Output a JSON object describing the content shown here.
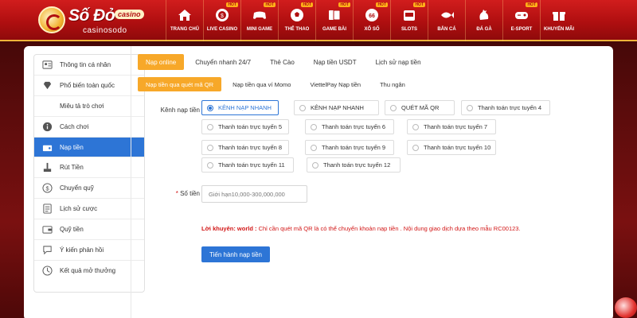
{
  "brand": {
    "name": "Số Đỏ",
    "badge": "casino",
    "subtitle": "casinosodo"
  },
  "nav": [
    {
      "label": "Trang chủ",
      "icon": "home-icon",
      "hot": ""
    },
    {
      "label": "Live Casino",
      "icon": "casino-chip-icon",
      "hot": "HOT"
    },
    {
      "label": "Mini Game",
      "icon": "gamepad-icon",
      "hot": "HOT"
    },
    {
      "label": "Thể Thao",
      "icon": "soccer-ball-icon",
      "hot": "HOT"
    },
    {
      "label": "Game Bài",
      "icon": "cards-icon",
      "hot": "HOT"
    },
    {
      "label": "Xổ Số",
      "icon": "lottery-ball-icon",
      "hot": "HOT"
    },
    {
      "label": "Slots",
      "icon": "slot-machine-icon",
      "hot": "HOT"
    },
    {
      "label": "Bắn Cá",
      "icon": "fish-icon",
      "hot": ""
    },
    {
      "label": "Đá Gà",
      "icon": "rooster-icon",
      "hot": ""
    },
    {
      "label": "E-Sport",
      "icon": "controller-icon",
      "hot": "HOT"
    },
    {
      "label": "Khuyến Mãi",
      "icon": "gift-icon",
      "hot": ""
    }
  ],
  "sidebar": [
    {
      "label": "Thông tin cá nhân",
      "icon": "profile-card-icon"
    },
    {
      "label": "Phổ biến toàn quốc",
      "icon": "diamond-icon"
    },
    {
      "label": "Miêu tả trò chơi",
      "icon": "gamepad-icon"
    },
    {
      "label": "Cách chơi",
      "icon": "info-icon"
    },
    {
      "label": "Nạp tiền",
      "icon": "deposit-icon"
    },
    {
      "label": "Rút Tiền",
      "icon": "withdraw-icon"
    },
    {
      "label": "Chuyển quỹ",
      "icon": "dollar-icon"
    },
    {
      "label": "Lịch sử cược",
      "icon": "history-doc-icon"
    },
    {
      "label": "Quỹ tiền",
      "icon": "wallet-icon"
    },
    {
      "label": "Ý kiến phản hồi",
      "icon": "feedback-icon"
    },
    {
      "label": "Kết quả mở thưởng",
      "icon": "clock-history-icon"
    }
  ],
  "tabs": [
    "Nạp online",
    "Chuyển nhanh 24/7",
    "Thẻ Cào",
    "Nạp tiền USDT",
    "Lịch sử nạp tiền"
  ],
  "subtabs": [
    "Nạp tiền qua quét mã QR",
    "Nạp tiền qua ví Momo",
    "ViettelPay Nạp tiền",
    "Thu ngân"
  ],
  "form": {
    "channel_label": "Kênh nạp tiền",
    "channels": [
      "KÊNH NẠP NHANH",
      "KÊNH NẠP NHANH",
      "QUÉT MÃ QR",
      "Thanh toán trực tuyến 4",
      "Thanh toán trực tuyến 5",
      "Thanh toán trực tuyến 6",
      "Thanh toán trực tuyến 7",
      "Thanh toán trực tuyến 8",
      "Thanh toán trực tuyến 9",
      "Thanh toán trực tuyến 10",
      "Thanh toán trực tuyến 11",
      "Thanh toán trực tuyến 12"
    ],
    "amount_label": "Số tiền",
    "amount_required": "*",
    "amount_placeholder": "Giới hạn10,000-300,000,000",
    "note_prefix": "Lời khuyên:  world :",
    "note_text": " Chỉ cần quét mã QR là có thể chuyển khoản nạp tiền . Nội dung giao dịch dựa theo mẫu RC00123.",
    "submit_label": "Tiến hành nạp tiền"
  },
  "colors": {
    "accent": "#f7a829",
    "primary": "#2d75d6",
    "header": "#b00f10",
    "warning": "#d21717"
  }
}
